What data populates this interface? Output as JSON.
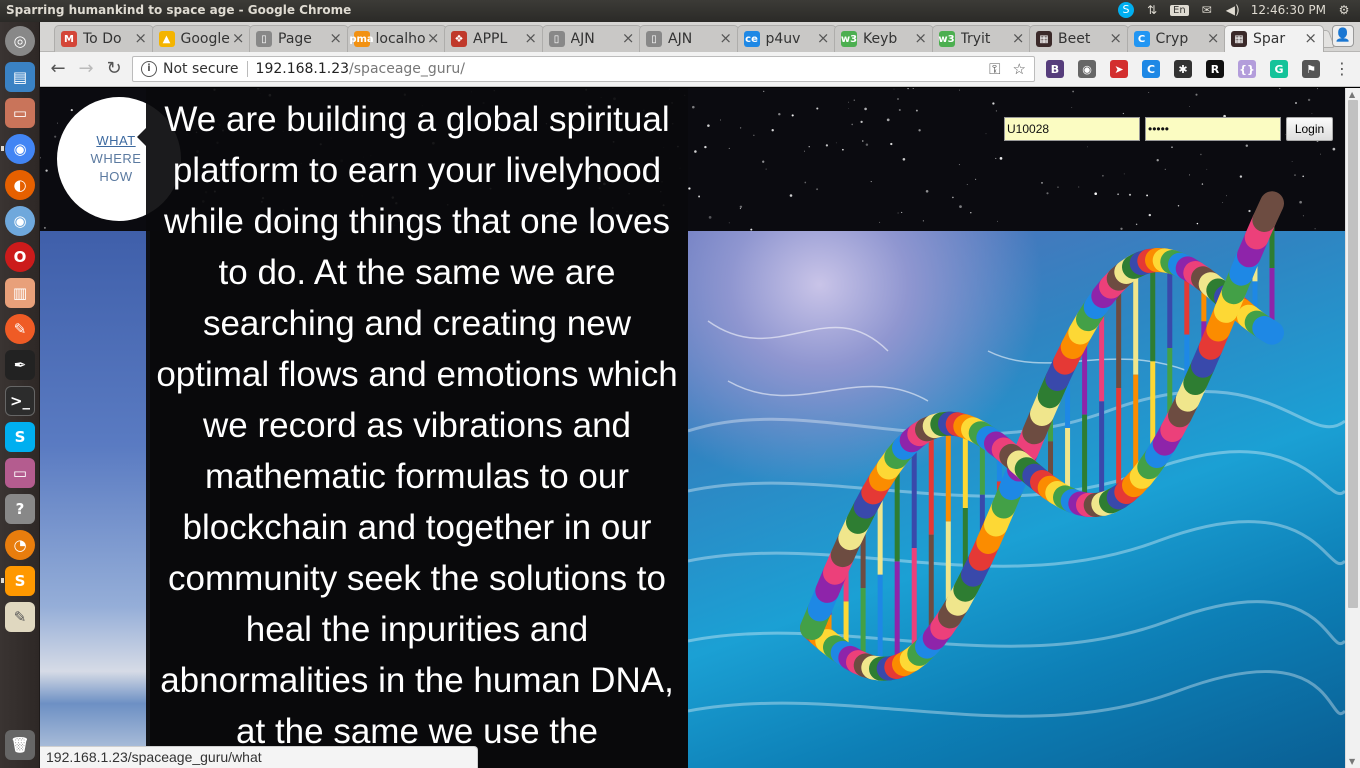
{
  "window": {
    "title": "Sparring humankind to space age - Google Chrome"
  },
  "tray": {
    "keyboard": "En",
    "clock": "12:46:30 PM"
  },
  "tabs": [
    {
      "label": "To Do",
      "favicon": "gmail-icon",
      "color": "#d44638",
      "glyph": "M",
      "active": false
    },
    {
      "label": "Google",
      "favicon": "drive-icon",
      "color": "#f4b400",
      "glyph": "▲",
      "active": false
    },
    {
      "label": "Page",
      "favicon": "page-icon",
      "color": "#888888",
      "glyph": "▯",
      "active": false
    },
    {
      "label": "localhost",
      "favicon": "phpmyadmin-icon",
      "color": "#f29111",
      "glyph": "pma",
      "active": false
    },
    {
      "label": "APPL",
      "favicon": "apple-icon",
      "color": "#c0392b",
      "glyph": "❖",
      "active": false
    },
    {
      "label": "AJN",
      "favicon": "page-icon",
      "color": "#888888",
      "glyph": "▯",
      "active": false
    },
    {
      "label": "AJN",
      "favicon": "page-icon",
      "color": "#888888",
      "glyph": "▯",
      "active": false
    },
    {
      "label": "p4uv",
      "favicon": "ce-icon",
      "color": "#1e88e5",
      "glyph": "ce",
      "active": false
    },
    {
      "label": "Keyb",
      "favicon": "w3-icon",
      "color": "#4caf50",
      "glyph": "w3",
      "active": false
    },
    {
      "label": "Tryit",
      "favicon": "w3-icon",
      "color": "#4caf50",
      "glyph": "w3",
      "active": false
    },
    {
      "label": "Beet",
      "favicon": "beet-icon",
      "color": "#3b2a2a",
      "glyph": "▦",
      "active": false
    },
    {
      "label": "Cryp",
      "favicon": "crypto-icon",
      "color": "#2196f3",
      "glyph": "C",
      "active": false
    },
    {
      "label": "Spar",
      "favicon": "spar-icon",
      "color": "#3b2a2a",
      "glyph": "▦",
      "active": true
    }
  ],
  "omnibox": {
    "security": "Not secure",
    "host": "192.168.1.23",
    "path": "/spaceage_guru/"
  },
  "extensions": [
    {
      "name": "bootstrap-icon",
      "glyph": "B",
      "color": "#563d7c"
    },
    {
      "name": "globe-icon",
      "glyph": "◉",
      "color": "#666666"
    },
    {
      "name": "bird-icon",
      "glyph": "➤",
      "color": "#d32f2f"
    },
    {
      "name": "c-icon",
      "glyph": "C",
      "color": "#1e88e5"
    },
    {
      "name": "bug-icon",
      "glyph": "✱",
      "color": "#333333"
    },
    {
      "name": "r-icon",
      "glyph": "R",
      "color": "#111111"
    },
    {
      "name": "json-icon",
      "glyph": "{}",
      "color": "#b39ddb"
    },
    {
      "name": "grammarly-icon",
      "glyph": "G",
      "color": "#15c39a"
    },
    {
      "name": "bookmark-icon",
      "glyph": "⚑",
      "color": "#555555"
    }
  ],
  "menu": {
    "what": "WHAT",
    "where": "WHERE",
    "how": "HOW"
  },
  "login": {
    "username": "U10028",
    "password": "•••••",
    "button": "Login"
  },
  "hero_text": "We are building a global spiritual platform to earn your livelyhood while doing things that one loves to do. At the same we are searching and creating new optimal flows and emotions which we record as vibrations and mathematic formulas to our blockchain and together in our community seek the solutions to heal the inpurities and abnormalities in the human DNA, at the same we use the",
  "status_url": "192.168.1.23/spaceage_guru/what"
}
